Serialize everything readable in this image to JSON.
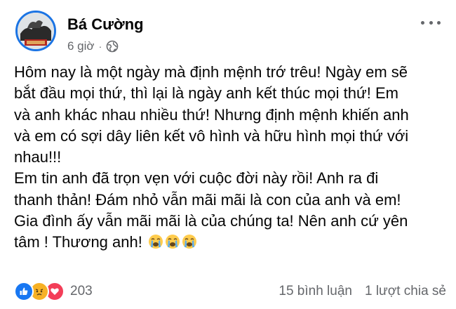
{
  "post": {
    "author": "Bá Cường",
    "time": "6 giờ",
    "separator": "·",
    "privacy_icon": "globe-icon",
    "more_icon": "more-horizontal-icon",
    "body_lines": [
      "Hôm nay là một ngày mà định mệnh trớ trêu! Ngày em sẽ",
      "bắt đầu mọi thứ, thì lại là ngày anh kết thúc mọi thứ! Em",
      "và anh khác nhau nhiều thứ! Nhưng định mệnh khiến anh",
      "và em có sợi dây liên kết vô hình và hữu hình mọi thứ với",
      "nhau!!!",
      "Em tin anh đã trọn vẹn với cuộc đời này rồi! Anh ra đi",
      "thanh thản! Đám nhỏ vẫn mãi mãi là con của anh và em!",
      "Gia đình ấy vẫn mãi mãi là của chúng ta! Nên anh cứ yên",
      "tâm ! Thương anh!"
    ],
    "trailing_emojis": [
      "crying-face-emoji",
      "crying-face-emoji",
      "crying-face-emoji"
    ]
  },
  "footer": {
    "reaction_icons": [
      "like-reaction-icon",
      "sad-reaction-icon",
      "love-reaction-icon"
    ],
    "reaction_count": "203",
    "comments": "15 bình luận",
    "shares": "1 lượt chia sẻ"
  },
  "colors": {
    "text": "#050505",
    "secondary_text": "#65676b",
    "like_blue": "#1877f2",
    "sad_yellow": "#f7b125",
    "love_red": "#f33e58",
    "avatar_ring": "#1b74e4"
  }
}
